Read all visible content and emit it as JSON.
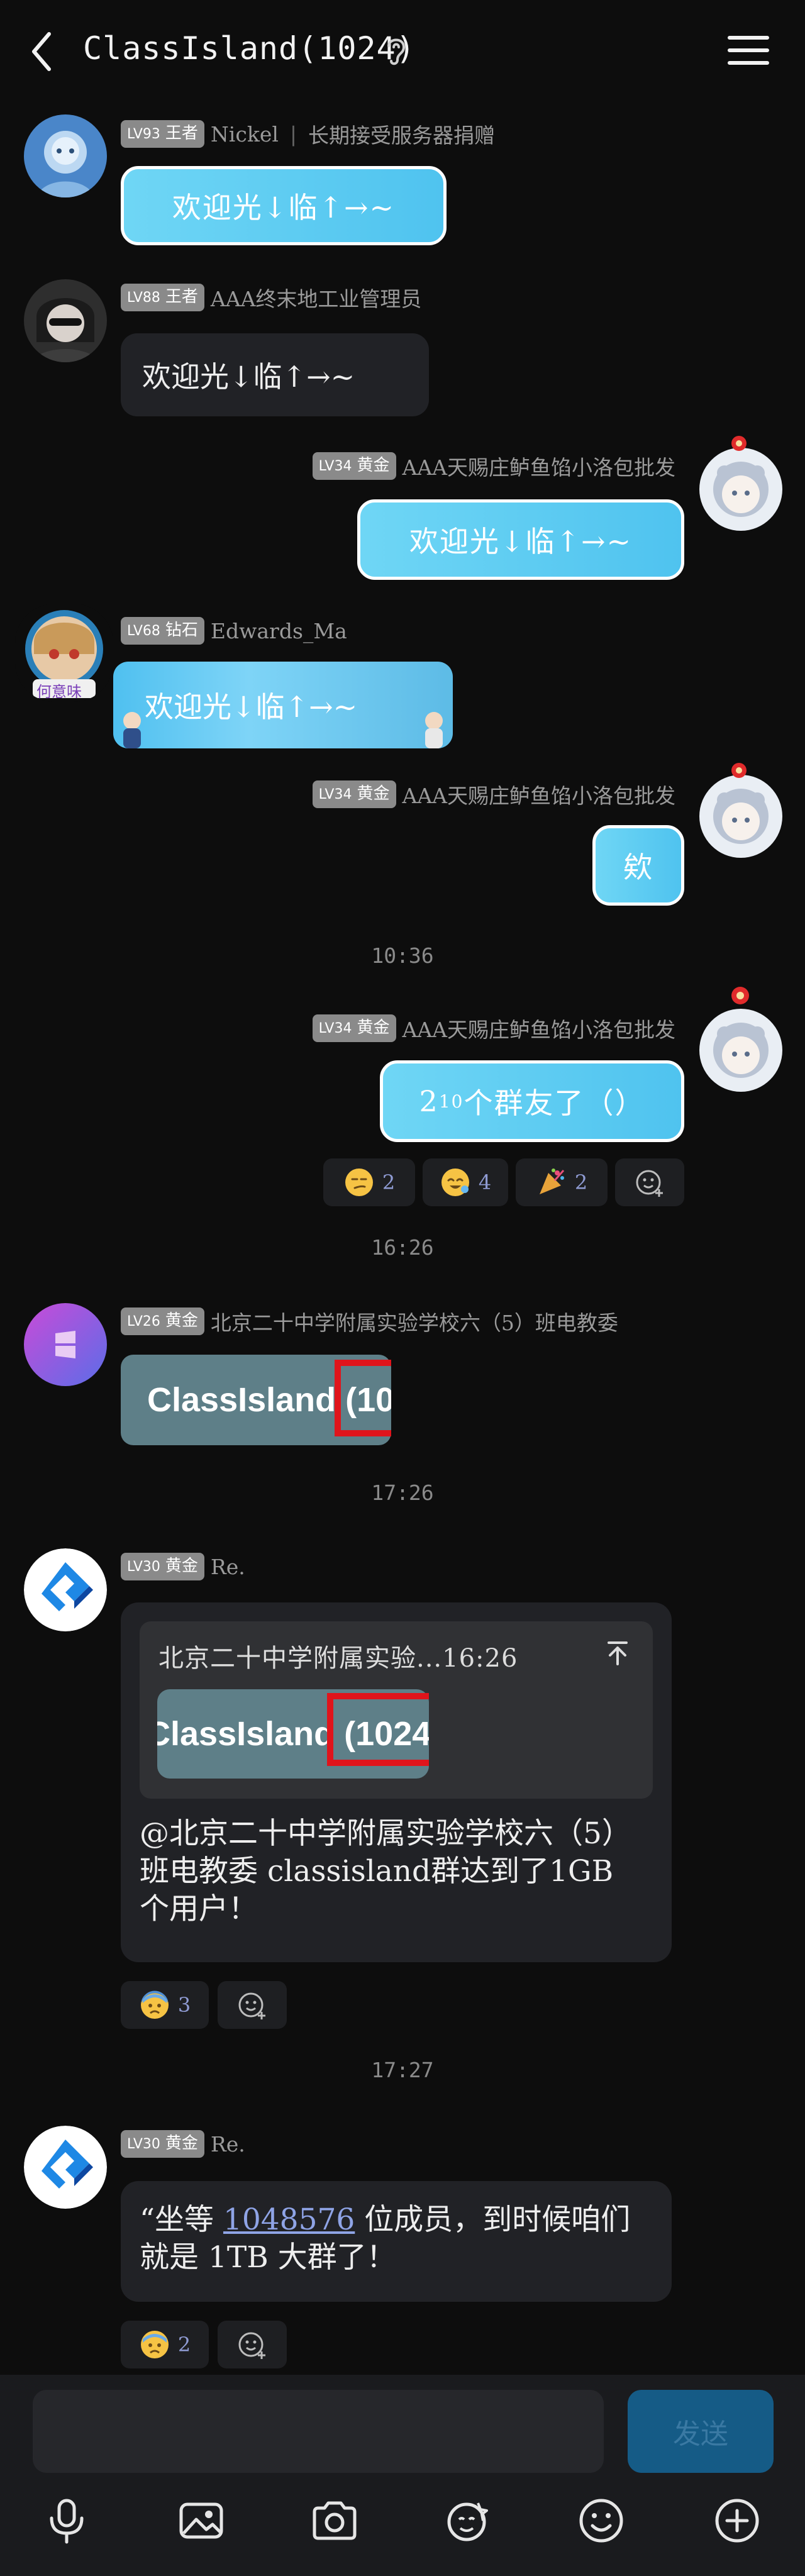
{
  "header": {
    "title": "ClassIsland(1024)"
  },
  "messages": {
    "m1": {
      "level": "LV93",
      "rank": "王者",
      "name": "Nickel",
      "title": "长期接受服务器捐赠",
      "text": "欢迎光↓临↑→~"
    },
    "m2": {
      "level": "LV88",
      "rank": "王者",
      "name": "AAA终末地工业管理员",
      "text": "欢迎光↓临↑→~"
    },
    "m3": {
      "level": "LV34",
      "rank": "黄金",
      "name": "AAA天赐庄鲈鱼馅小洛包批发",
      "text": "欢迎光↓临↑→~"
    },
    "m4": {
      "level": "LV68",
      "rank": "钻石",
      "name": "Edwards_Ma",
      "text": "欢迎光↓临↑→~",
      "avatar_caption": "何意味"
    },
    "m5": {
      "level": "LV34",
      "rank": "黄金",
      "name": "AAA天赐庄鲈鱼馅小洛包批发",
      "text": "欸"
    },
    "time1": "10:36",
    "m6": {
      "level": "LV34",
      "rank": "黄金",
      "name": "AAA天赐庄鲈鱼馅小洛包批发",
      "text_base": "2",
      "text_sup": "10",
      "text_rest": "个群友了（）"
    },
    "m6_reactions": [
      "2",
      "4",
      "2"
    ],
    "time2": "16:26",
    "m7": {
      "level": "LV26",
      "rank": "黄金",
      "name": "北京二十中学附属实验学校六（5）班电教委",
      "image_text": "ClassIsland (10"
    },
    "time3": "17:26",
    "m8": {
      "level": "LV30",
      "rank": "黄金",
      "name": "Re.",
      "quote_header": "北京二十中学附属实验...16:26",
      "quote_image_text": "ClassIsland (1024",
      "text": "@北京二十中学附属实验学校六（5）班电教委 classisland群达到了1GB个用户！",
      "reaction_count": "3"
    },
    "time4": "17:27",
    "m9": {
      "level": "LV30",
      "rank": "黄金",
      "name": "Re.",
      "text_pre": "“坐等 ",
      "link": "1048576",
      "text_post": " 位成员，到时候咱们就是 1TB 大群了！",
      "reaction_count": "2"
    }
  },
  "input": {
    "placeholder": "",
    "send_label": "发送"
  },
  "toolbar": {
    "icons": [
      "microphone-icon",
      "image-icon",
      "camera-icon",
      "sticker-icon",
      "emoji-icon",
      "plus-icon"
    ]
  },
  "colors": {
    "background": "#0d0d0d",
    "bubble_blue": "#5cc9f2",
    "bubble_dark": "#212226",
    "send_button": "#155b86"
  }
}
